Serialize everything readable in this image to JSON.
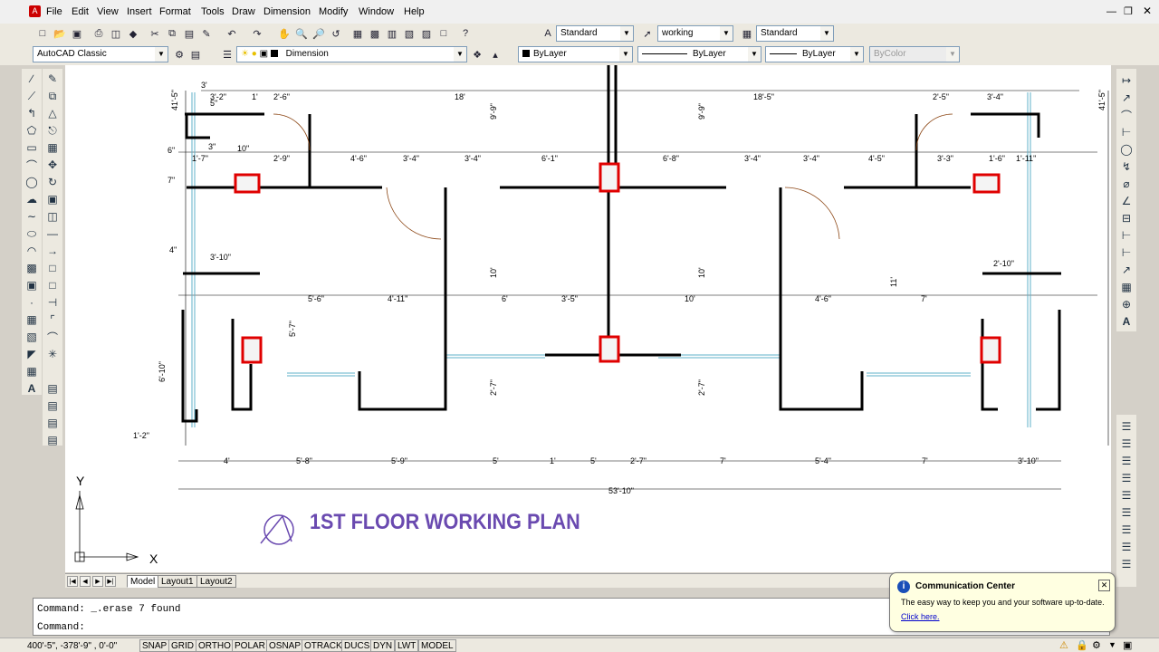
{
  "menu": [
    "File",
    "Edit",
    "View",
    "Insert",
    "Format",
    "Tools",
    "Draw",
    "Dimension",
    "Modify",
    "Window",
    "Help"
  ],
  "styles_toolbar": {
    "text_style": "Standard",
    "dim_style": "working",
    "table_style": "Standard"
  },
  "layers_toolbar": {
    "workspace": "AutoCAD Classic",
    "layer": "Dimension",
    "color": "ByLayer",
    "linetype": "ByLayer",
    "lineweight": "ByLayer",
    "plotstyle": "ByColor"
  },
  "drawing": {
    "title": "1ST FLOOR WORKING PLAN",
    "ucs_y": "Y",
    "ucs_x": "X",
    "overall_dim": "53'-10\"",
    "top_dims": [
      "3'",
      "3'-2\"",
      "1'",
      "2'-6\"",
      "18'",
      "18'-5\"",
      "2'-5\"",
      "3'-4\""
    ],
    "mid_dims": [
      "1'-7\"",
      "2'-9\"",
      "4'-6\"",
      "3'-4\"",
      "3'-4\"",
      "6'-1\"",
      "6'-8\"",
      "3'-4\"",
      "3'-4\"",
      "4'-5\"",
      "3'-3\"",
      "1'-6\"",
      "1'-11\""
    ],
    "row2_dims": [
      "5'-6\"",
      "4'-11\"",
      "6'",
      "3'-5\"",
      "10'",
      "4'-6\"",
      "7'"
    ],
    "bottom_dims": [
      "4'",
      "5'-8\"",
      "5'-9\"",
      "5'",
      "1'",
      "5'",
      "2'-7\"",
      "7'",
      "5'-4\"",
      "7'",
      "3'-10\""
    ],
    "vertical_dims": [
      "41'-5\"",
      "41'-5\"",
      "9'-9\"",
      "9'-9\"",
      "10'",
      "10'",
      "11'",
      "5'-7\"",
      "6'-10\"",
      "2'-7\"",
      "2'-7\""
    ],
    "small_dims": [
      "5\"",
      "6\"",
      "7\"",
      "3\"",
      "4\"",
      "10\"",
      "1'-2\"",
      "3'-10\"",
      "2'-10\""
    ]
  },
  "layout_tabs": [
    "Model",
    "Layout1",
    "Layout2"
  ],
  "command_lines": [
    "Command:  _.erase 7 found",
    "Command:"
  ],
  "status": {
    "coords": "400'-5\",  -378'-9\" , 0'-0\"",
    "buttons": [
      "SNAP",
      "GRID",
      "ORTHO",
      "POLAR",
      "OSNAP",
      "OTRACK",
      "DUCS",
      "DYN",
      "LWT",
      "MODEL"
    ]
  },
  "balloon": {
    "title": "Communication Center",
    "text": "The easy way to keep you and your software up-to-date.",
    "link": "Click here."
  },
  "colors": {
    "highlight_red": "#e00000",
    "title_purple": "#6a4ab0",
    "window_cyan": "#5fb0c8",
    "door_arc": "#8b4513"
  }
}
